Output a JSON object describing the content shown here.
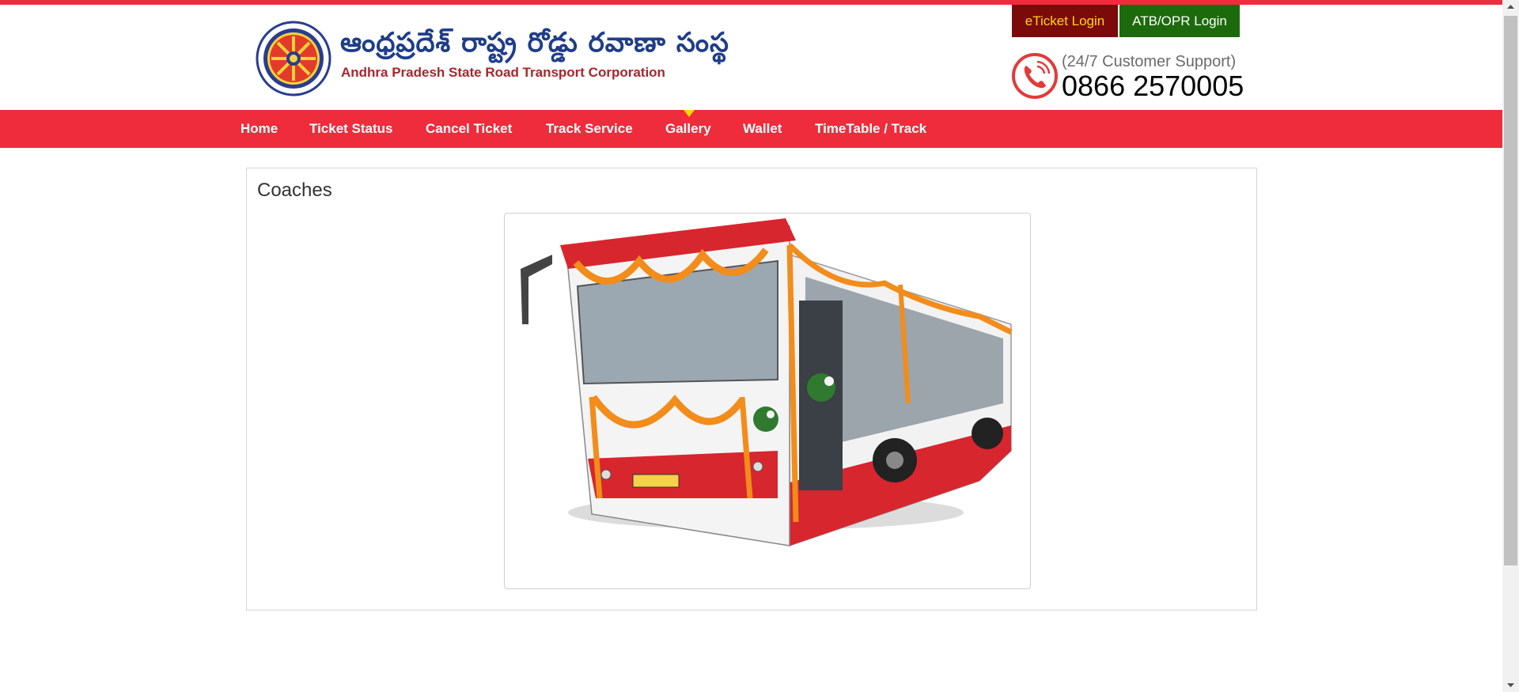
{
  "header": {
    "telugu_title": "ఆంధ్రప్రదేశ్ రాష్ట్ర రోడ్డు రవాణా సంస్థ",
    "english_title": "Andhra Pradesh State Road Transport Corporation",
    "logo_icon": "apsrtc-logo",
    "eticket_login": "eTicket Login",
    "atb_login": "ATB/OPR Login",
    "support_label": "(24/7 Customer Support)",
    "support_number": "0866 2570005",
    "phone_icon": "phone-icon"
  },
  "nav": {
    "items": [
      {
        "label": "Home"
      },
      {
        "label": "Ticket Status"
      },
      {
        "label": "Cancel Ticket"
      },
      {
        "label": "Track Service"
      },
      {
        "label": "Gallery"
      },
      {
        "label": "Wallet"
      },
      {
        "label": "TimeTable / Track"
      }
    ],
    "active": "Gallery"
  },
  "content": {
    "section_title": "Coaches",
    "image_icon": "bus-photo"
  },
  "colors": {
    "brand_red": "#ee2c3c",
    "eticket_bg": "#7b0a0a",
    "eticket_text": "#ffd700",
    "atb_bg": "#1c6a0c",
    "title_blue": "#1f3d8a",
    "title_red": "#a8262c"
  }
}
